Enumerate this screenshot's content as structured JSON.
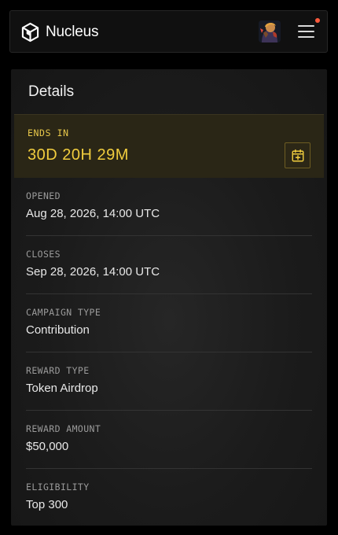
{
  "header": {
    "brand": "Nucleus",
    "has_notification": true
  },
  "details": {
    "title": "Details",
    "ends_in": {
      "label": "ENDS IN",
      "value": "30D 20H 29M"
    },
    "rows": [
      {
        "label": "OPENED",
        "value": "Aug 28, 2026, 14:00 UTC"
      },
      {
        "label": "CLOSES",
        "value": "Sep 28, 2026, 14:00 UTC"
      },
      {
        "label": "CAMPAIGN TYPE",
        "value": "Contribution"
      },
      {
        "label": "REWARD TYPE",
        "value": "Token Airdrop"
      },
      {
        "label": "REWARD AMOUNT",
        "value": "$50,000"
      },
      {
        "label": "ELIGIBILITY",
        "value": "Top 300"
      }
    ]
  },
  "colors": {
    "accent_gold": "#f1cd3e",
    "notification_dot": "#ff5a3c"
  }
}
